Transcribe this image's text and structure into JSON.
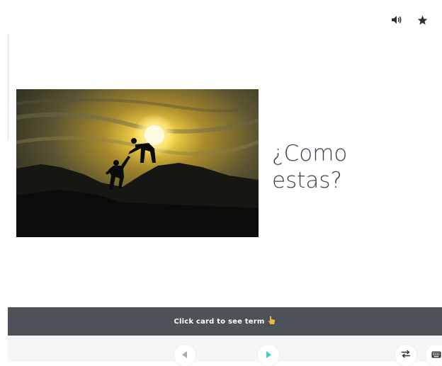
{
  "card": {
    "definition": "¿Como estas?",
    "image_alt": "Two climbers silhouetted on a rocky peak at sunset, one helping the other up"
  },
  "top_icons": [
    "speaker-icon",
    "star-icon"
  ],
  "hint": {
    "text": "Click card to see term",
    "icon": "pointing-hand-icon"
  },
  "controls": {
    "prev": "left-arrow-icon",
    "next": "right-arrow-icon",
    "flip": "swap-arrows-icon",
    "keyboard": "keyboard-icon"
  },
  "colors": {
    "hint_bar": "#4c5257",
    "text": "#3f4450",
    "accent": "#3ccfcf",
    "icon": "#2e3135",
    "control_bg": "#f5f6f7"
  }
}
